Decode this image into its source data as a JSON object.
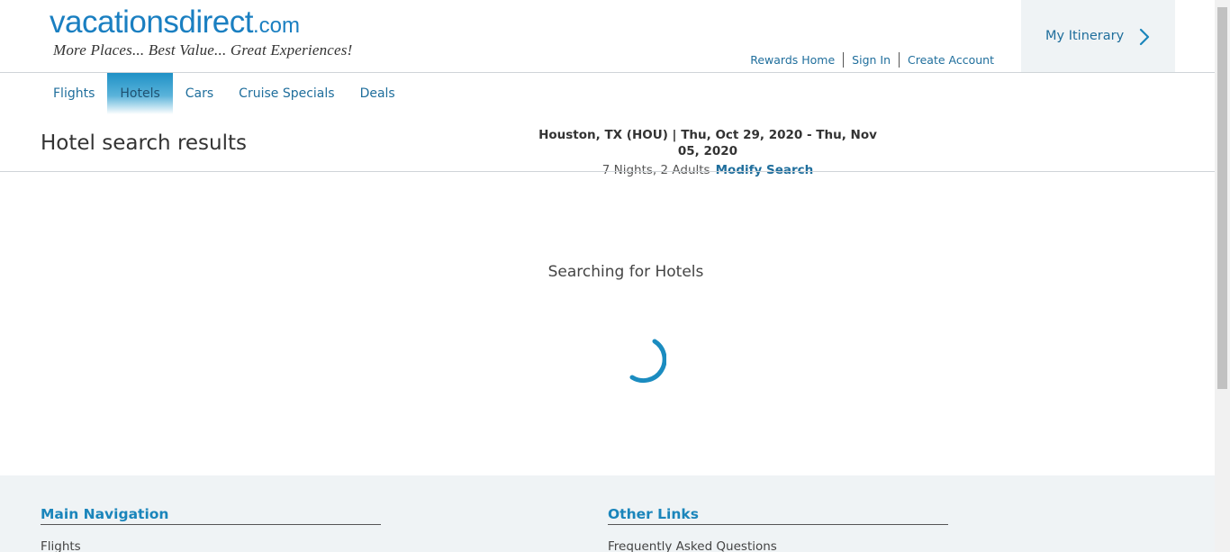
{
  "logo": {
    "main": "vacationsdirect",
    "suffix": ".com",
    "tagline": "More Places... Best Value... Great Experiences!"
  },
  "account_links": [
    "Rewards Home",
    "Sign In",
    "Create Account"
  ],
  "itinerary": {
    "label": "My Itinerary",
    "icon": "chevron-right-icon"
  },
  "nav": {
    "tabs": [
      "Flights",
      "Hotels",
      "Cars",
      "Cruise Specials",
      "Deals"
    ],
    "active": "Hotels"
  },
  "page_title": "Hotel search results",
  "search_summary": {
    "destination_dates": "Houston, TX (HOU) | Thu, Oct 29, 2020 - Thu, Nov 05, 2020",
    "details": "7 Nights, 2 Adults",
    "modify_label": "Modify Search"
  },
  "loading": {
    "text": "Searching for Hotels",
    "icon": "loading-spinner-icon"
  },
  "footer": {
    "main_nav_heading": "Main Navigation",
    "main_nav_first": "Flights",
    "other_links_heading": "Other Links",
    "other_links_first": "Frequently Asked Questions"
  },
  "colors": {
    "brand_blue": "#1a7fc1",
    "link_blue": "#1f6e9c",
    "panel_bg": "#eff3f5",
    "spinner": "#1b8cc0"
  }
}
